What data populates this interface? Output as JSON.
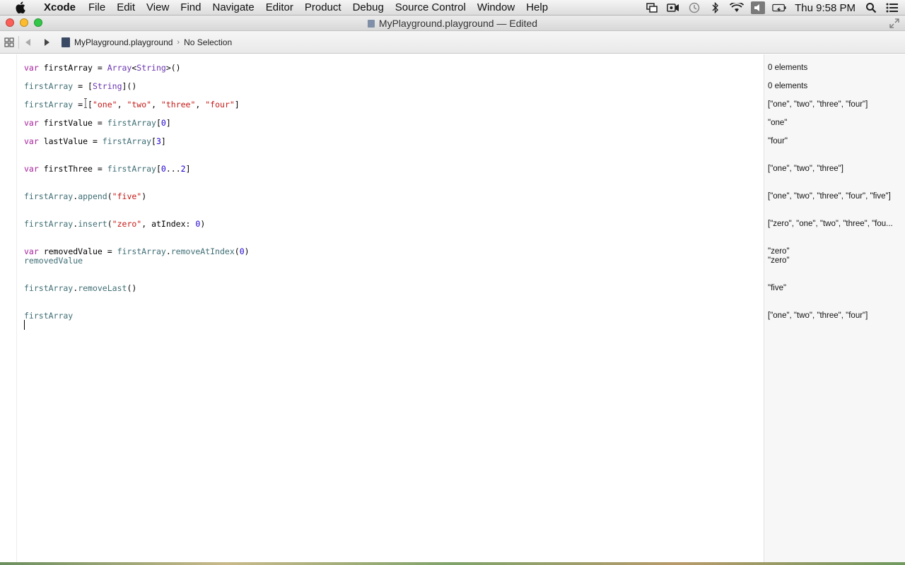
{
  "menubar": {
    "app_name": "Xcode",
    "items": [
      "File",
      "Edit",
      "View",
      "Find",
      "Navigate",
      "Editor",
      "Product",
      "Debug",
      "Source Control",
      "Window",
      "Help"
    ],
    "clock": "Thu 9:58 PM",
    "status_icons": [
      "screen-sharing-icon",
      "camera-icon",
      "time-machine-icon",
      "bluetooth-icon",
      "wifi-icon",
      "volume-icon",
      "battery-icon",
      "spotlight-icon",
      "notification-center-icon"
    ]
  },
  "window": {
    "title": "MyPlayground.playground — Edited"
  },
  "jumpbar": {
    "file": "MyPlayground.playground",
    "selection": "No Selection"
  },
  "code": {
    "l1": {
      "kw": "var",
      "name": " firstArray = ",
      "type1": "Array",
      "lt": "<",
      "type2": "String",
      "rest": ">()"
    },
    "l2": {
      "id": "firstArray",
      "mid": " = [",
      "type": "String",
      "rest": "]()"
    },
    "l3": {
      "id": "firstArray",
      "mid": " = [",
      "s1": "\"one\"",
      "c1": ", ",
      "s2": "\"two\"",
      "c2": ", ",
      "s3": "\"three\"",
      "c3": ", ",
      "s4": "\"four\"",
      "end": "]"
    },
    "l4": {
      "kw": "var",
      "name": " firstValue = ",
      "id": "firstArray",
      "open": "[",
      "n": "0",
      "close": "]"
    },
    "l5": {
      "kw": "var",
      "name": " lastValue = ",
      "id": "firstArray",
      "open": "[",
      "n": "3",
      "close": "]"
    },
    "l6": {
      "kw": "var",
      "name": " firstThree = ",
      "id": "firstArray",
      "open": "[",
      "n1": "0",
      "dots": "...",
      "n2": "2",
      "close": "]"
    },
    "l7": {
      "id": "firstArray",
      "dot": ".",
      "fn": "append",
      "open": "(",
      "s": "\"five\"",
      "close": ")"
    },
    "l8": {
      "id": "firstArray",
      "dot": ".",
      "fn": "insert",
      "open": "(",
      "s": "\"zero\"",
      "mid": ", atIndex: ",
      "n": "0",
      "close": ")"
    },
    "l9": {
      "kw": "var",
      "name": " removedValue = ",
      "id": "firstArray",
      "dot": ".",
      "fn": "removeAtIndex",
      "open": "(",
      "n": "0",
      "close": ")"
    },
    "l10": {
      "id": "removedValue"
    },
    "l11": {
      "id": "firstArray",
      "dot": ".",
      "fn": "removeLast",
      "rest": "()"
    },
    "l12": {
      "id": "firstArray"
    }
  },
  "results": {
    "r1": "0 elements",
    "r2": "0 elements",
    "r3": "[\"one\", \"two\", \"three\", \"four\"]",
    "r4": "\"one\"",
    "r5": "\"four\"",
    "r6": "[\"one\", \"two\", \"three\"]",
    "r7": "[\"one\", \"two\", \"three\", \"four\", \"five\"]",
    "r8": "[\"zero\", \"one\", \"two\", \"three\", \"fou...",
    "r9": "\"zero\"",
    "r10": "\"zero\"",
    "r11": "\"five\"",
    "r12": "[\"one\", \"two\", \"three\", \"four\"]"
  }
}
